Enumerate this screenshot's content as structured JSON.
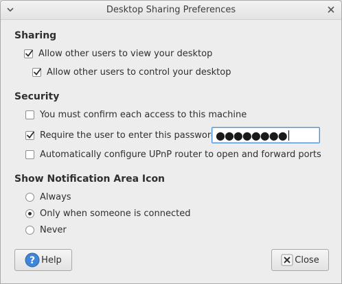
{
  "window": {
    "title": "Desktop Sharing Preferences"
  },
  "sharing": {
    "heading": "Sharing",
    "view": {
      "label": "Allow other users to view your desktop",
      "checked": true
    },
    "control": {
      "label": "Allow other users to control your desktop",
      "checked": true
    }
  },
  "security": {
    "heading": "Security",
    "confirm": {
      "label": "You must confirm each access to this machine",
      "checked": false
    },
    "password": {
      "label": "Require the user to enter this password:",
      "checked": true,
      "value": "●●●●●●●●"
    },
    "upnp": {
      "label": "Automatically configure UPnP router to open and forward ports",
      "checked": false
    }
  },
  "notification": {
    "heading": "Show Notification Area Icon",
    "options": [
      {
        "label": "Always",
        "selected": false
      },
      {
        "label": "Only when someone is connected",
        "selected": true
      },
      {
        "label": "Never",
        "selected": false
      }
    ]
  },
  "buttons": {
    "help": "Help",
    "close": "Close"
  },
  "icons": {
    "help": "help-icon",
    "close": "close-icon",
    "menu": "window-menu-icon",
    "window_close": "window-close-icon"
  },
  "colors": {
    "focus": "#4a8ed9",
    "help_icon": "#3f86d6"
  }
}
